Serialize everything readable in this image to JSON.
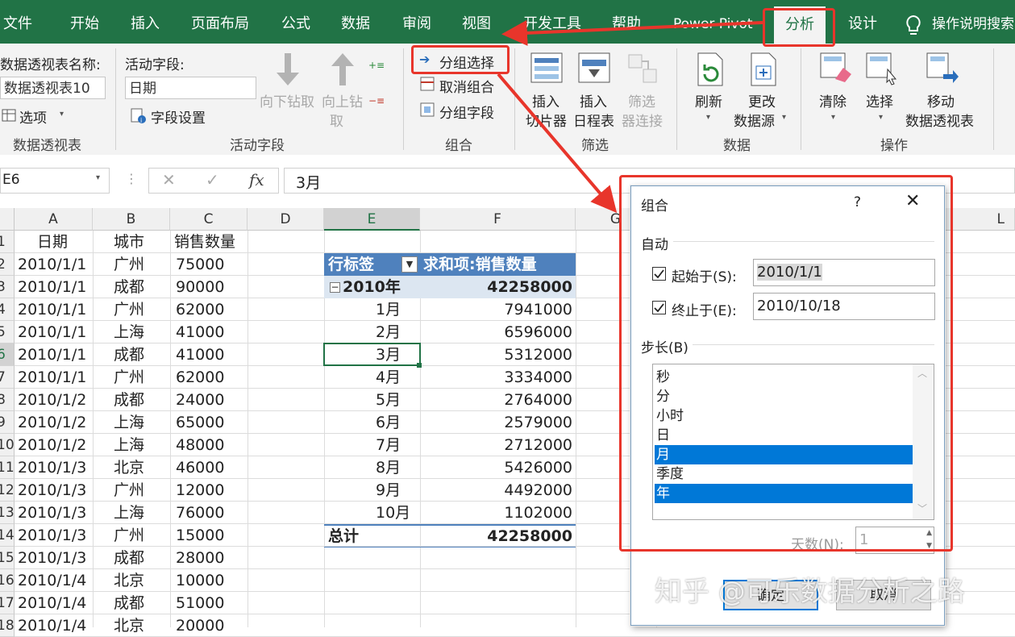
{
  "ribbon_tabs": [
    "文件",
    "开始",
    "插入",
    "页面布局",
    "公式",
    "数据",
    "审阅",
    "视图",
    "开发工具",
    "帮助",
    "Power Pivot",
    "分析",
    "设计"
  ],
  "active_tab": "分析",
  "tell_me": "操作说明搜索",
  "ribbon": {
    "pivot_name_label": "数据透视表名称:",
    "pivot_name_value": "数据透视表10",
    "options_label": "选项",
    "group_pivot": "数据透视表",
    "active_field_label": "活动字段:",
    "active_field_value": "日期",
    "field_settings": "字段设置",
    "drill_down": "向下钻取",
    "drill_up_1": "向上钻",
    "drill_up_2": "取",
    "group_active_field": "活动字段",
    "group_selection": "分组选择",
    "ungroup": "取消组合",
    "group_field": "分组字段",
    "group_group": "组合",
    "insert_slicer_1": "插入",
    "insert_slicer_2": "切片器",
    "insert_timeline_1": "插入",
    "insert_timeline_2": "日程表",
    "filter_conn_1": "筛选",
    "filter_conn_2": "器连接",
    "group_filter": "筛选",
    "refresh": "刷新",
    "change_source_1": "更改",
    "change_source_2": "数据源",
    "group_data": "数据",
    "clear": "清除",
    "select": "选择",
    "move_1": "移动",
    "move_2": "数据透视表",
    "group_actions": "操作"
  },
  "formula_bar": {
    "name_box": "E6",
    "fx": "fx",
    "value": "3月"
  },
  "columns": [
    "A",
    "B",
    "C",
    "D",
    "E",
    "F",
    "G",
    "L"
  ],
  "rows": [
    "1",
    "2",
    "3",
    "4",
    "5",
    "6",
    "7",
    "8",
    "9",
    "10",
    "11",
    "12",
    "13",
    "14",
    "15",
    "16",
    "17",
    "18"
  ],
  "table_header": [
    "日期",
    "城市",
    "销售数量"
  ],
  "table_rows": [
    [
      "2010/1/1",
      "广州",
      "75000"
    ],
    [
      "2010/1/1",
      "成都",
      "90000"
    ],
    [
      "2010/1/1",
      "广州",
      "62000"
    ],
    [
      "2010/1/1",
      "上海",
      "41000"
    ],
    [
      "2010/1/1",
      "成都",
      "41000"
    ],
    [
      "2010/1/1",
      "广州",
      "62000"
    ],
    [
      "2010/1/2",
      "成都",
      "24000"
    ],
    [
      "2010/1/2",
      "上海",
      "65000"
    ],
    [
      "2010/1/2",
      "上海",
      "48000"
    ],
    [
      "2010/1/3",
      "北京",
      "46000"
    ],
    [
      "2010/1/3",
      "广州",
      "12000"
    ],
    [
      "2010/1/3",
      "上海",
      "76000"
    ],
    [
      "2010/1/3",
      "广州",
      "15000"
    ],
    [
      "2010/1/3",
      "成都",
      "28000"
    ],
    [
      "2010/1/4",
      "北京",
      "10000"
    ],
    [
      "2010/1/4",
      "成都",
      "51000"
    ],
    [
      "2010/1/4",
      "北京",
      "20000"
    ]
  ],
  "pivot": {
    "row_label": "行标签",
    "value_label": "求和项:销售数量",
    "year_label": "2010年",
    "year_total": "42258000",
    "months": [
      [
        "1月",
        "7941000"
      ],
      [
        "2月",
        "6596000"
      ],
      [
        "3月",
        "5312000"
      ],
      [
        "4月",
        "3334000"
      ],
      [
        "5月",
        "2764000"
      ],
      [
        "6月",
        "2579000"
      ],
      [
        "7月",
        "2712000"
      ],
      [
        "8月",
        "5426000"
      ],
      [
        "9月",
        "4492000"
      ],
      [
        "10月",
        "1102000"
      ]
    ],
    "grand_total_label": "总计",
    "grand_total": "42258000"
  },
  "dialog": {
    "title": "组合",
    "help": "?",
    "auto_label": "自动",
    "start_label": "起始于(S):",
    "start_value": "2010/1/1",
    "end_label": "终止于(E):",
    "end_value": "2010/10/18",
    "step_label": "步长(B)",
    "steps": [
      "秒",
      "分",
      "小时",
      "日",
      "月",
      "季度",
      "年"
    ],
    "selected_steps": [
      "月",
      "年"
    ],
    "days_label": "天数(N):",
    "days_value": "1",
    "ok": "确定",
    "cancel": "取消"
  },
  "watermark": "知乎 @可乐数据分析之路",
  "colors": {
    "excel_green": "#217346",
    "highlight_red": "#e8352b",
    "pivot_header": "#4f81bd",
    "select_blue": "#0078d7"
  }
}
